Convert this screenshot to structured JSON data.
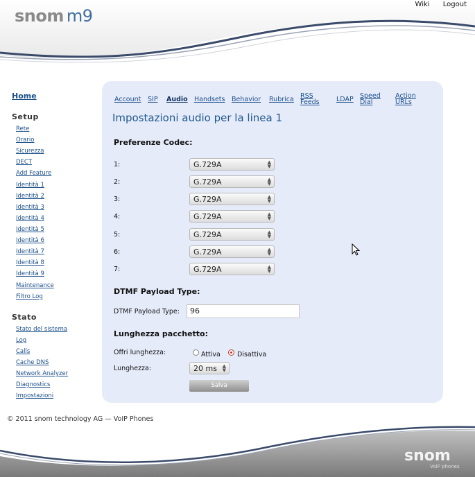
{
  "header": {
    "links": [
      "Wiki",
      "Logout"
    ],
    "logo_brand": "snom",
    "logo_model": "m9"
  },
  "sidebar": {
    "home": "Home",
    "setup_heading": "Setup",
    "setup_items": [
      "Rete",
      "Orario",
      "Sicurezza",
      "DECT",
      "Add Feature",
      "Identità 1",
      "Identità 2",
      "Identità 3",
      "Identità 4",
      "Identità 5",
      "Identità 6",
      "Identità 7",
      "Identità 8",
      "Identità 9",
      "Maintenance",
      "Filtro Log"
    ],
    "stato_heading": "Stato",
    "stato_items": [
      "Stato del sistema",
      "Log",
      "Calls",
      "Cache DNS",
      "Network Analyzer",
      "Diagnostics",
      "Impostazioni"
    ]
  },
  "tabs": [
    {
      "label": "Account",
      "active": false
    },
    {
      "label": "SIP",
      "active": false
    },
    {
      "label": "Audio",
      "active": true
    },
    {
      "label": "Handsets",
      "active": false
    },
    {
      "label": "Behavior",
      "active": false
    },
    {
      "label": "Rubrica",
      "active": false
    },
    {
      "label": "RSS Feeds",
      "line1": "RSS",
      "line2": "Feeds",
      "active": false
    },
    {
      "label": "LDAP",
      "active": false
    },
    {
      "label": "Speed Dial",
      "line1": "Speed",
      "line2": "Dial",
      "active": false
    },
    {
      "label": "Action URLs",
      "line1": "Action",
      "line2": "URLs",
      "active": false
    }
  ],
  "main": {
    "title": "Impostazioni audio per la linea 1",
    "codec_heading": "Preferenze Codec:",
    "codecs": [
      {
        "label": "1:",
        "value": "G.729A"
      },
      {
        "label": "2:",
        "value": "G.729A"
      },
      {
        "label": "3:",
        "value": "G.729A"
      },
      {
        "label": "4:",
        "value": "G.729A"
      },
      {
        "label": "5:",
        "value": "G.729A"
      },
      {
        "label": "6:",
        "value": "G.729A"
      },
      {
        "label": "7:",
        "value": "G.729A"
      }
    ],
    "dtmf_heading": "DTMF Payload Type:",
    "dtmf_label": "DTMF Payload Type:",
    "dtmf_value": "96",
    "packet_heading": "Lunghezza pacchetto:",
    "offer_label": "Offri lunghezza:",
    "radio_on": "Attiva",
    "radio_off": "Disattiva",
    "selected_radio": "Disattiva",
    "length_label": "Lunghezza:",
    "length_value": "20 ms",
    "save_label": "Salva"
  },
  "footer": {
    "copyright": "© 2011 snom technology AG — VoIP Phones",
    "logo": "snom",
    "sub": "VoIP phones"
  },
  "colors": {
    "panel_bg": "#e6ebfa",
    "link": "#1a4f8a",
    "title": "#1f5890",
    "wave_dark": "#3a4a6a"
  }
}
